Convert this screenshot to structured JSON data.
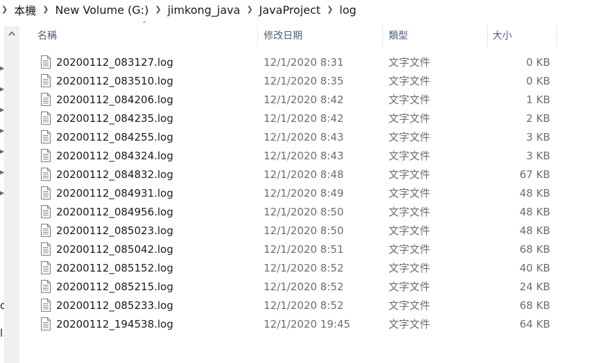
{
  "breadcrumb": {
    "items": [
      "本機",
      "New Volume (G:)",
      "jimkong_java",
      "JavaProject",
      "log"
    ]
  },
  "columns": {
    "name": "名稱",
    "date": "修改日期",
    "type": "類型",
    "size": "大小"
  },
  "nav_cut_text": [
    "o",
    "l."
  ],
  "files": [
    {
      "name": "20200112_083127.log",
      "date": "12/1/2020 8:31",
      "type": "文字文件",
      "size": "0 KB"
    },
    {
      "name": "20200112_083510.log",
      "date": "12/1/2020 8:35",
      "type": "文字文件",
      "size": "0 KB"
    },
    {
      "name": "20200112_084206.log",
      "date": "12/1/2020 8:42",
      "type": "文字文件",
      "size": "1 KB"
    },
    {
      "name": "20200112_084235.log",
      "date": "12/1/2020 8:42",
      "type": "文字文件",
      "size": "2 KB"
    },
    {
      "name": "20200112_084255.log",
      "date": "12/1/2020 8:43",
      "type": "文字文件",
      "size": "3 KB"
    },
    {
      "name": "20200112_084324.log",
      "date": "12/1/2020 8:43",
      "type": "文字文件",
      "size": "3 KB"
    },
    {
      "name": "20200112_084832.log",
      "date": "12/1/2020 8:48",
      "type": "文字文件",
      "size": "67 KB"
    },
    {
      "name": "20200112_084931.log",
      "date": "12/1/2020 8:49",
      "type": "文字文件",
      "size": "48 KB"
    },
    {
      "name": "20200112_084956.log",
      "date": "12/1/2020 8:50",
      "type": "文字文件",
      "size": "48 KB"
    },
    {
      "name": "20200112_085023.log",
      "date": "12/1/2020 8:50",
      "type": "文字文件",
      "size": "48 KB"
    },
    {
      "name": "20200112_085042.log",
      "date": "12/1/2020 8:51",
      "type": "文字文件",
      "size": "68 KB"
    },
    {
      "name": "20200112_085152.log",
      "date": "12/1/2020 8:52",
      "type": "文字文件",
      "size": "40 KB"
    },
    {
      "name": "20200112_085215.log",
      "date": "12/1/2020 8:52",
      "type": "文字文件",
      "size": "24 KB"
    },
    {
      "name": "20200112_085233.log",
      "date": "12/1/2020 8:52",
      "type": "文字文件",
      "size": "68 KB"
    },
    {
      "name": "20200112_194538.log",
      "date": "12/1/2020 19:45",
      "type": "文字文件",
      "size": "64 KB"
    }
  ],
  "icons": {
    "file": "text-document-icon",
    "breadcrumb_separator": "chevron-right-icon",
    "sort": "sort-ascending-icon",
    "nav_expand": "chevron-right-icon",
    "scroll_up": "scroll-up-arrow-icon"
  },
  "colors": {
    "header_text": "#4c607a",
    "secondary_text": "#6d6d6d",
    "primary_text": "#1a1a1a"
  }
}
